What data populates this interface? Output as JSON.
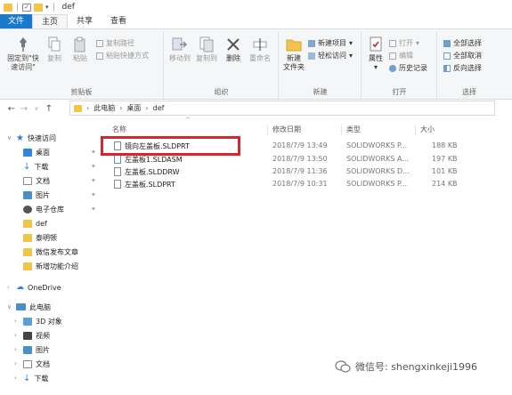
{
  "window": {
    "title": "def"
  },
  "tabs": [
    "文件",
    "主页",
    "共享",
    "查看"
  ],
  "ribbon": {
    "clipboard": {
      "pin_label": "固定到\"快\n速访问\"",
      "copy_label": "复制",
      "paste_label": "粘贴",
      "copy_path_label": "复制路径",
      "paste_shortcut_label": "粘贴快捷方式",
      "group_label": "剪贴板"
    },
    "organize": {
      "move_label": "移动到",
      "copyto_label": "复制到",
      "delete_label": "删除",
      "rename_label": "重命名",
      "group_label": "组织"
    },
    "new": {
      "new_folder_label": "新建\n文件夹",
      "new_item_label": "新建项目",
      "easy_access_label": "轻松访问",
      "group_label": "新建"
    },
    "open": {
      "properties_label": "属性",
      "open_label": "打开",
      "edit_label": "编辑",
      "history_label": "历史记录",
      "group_label": "打开"
    },
    "select": {
      "select_all_label": "全部选择",
      "select_none_label": "全部取消",
      "invert_label": "反向选择",
      "group_label": "选择"
    }
  },
  "address": {
    "crumbs": [
      "此电脑",
      "桌面",
      "def"
    ]
  },
  "navpane": {
    "quick_access": "快速访问",
    "items": [
      "桌面",
      "下载",
      "文档",
      "图片",
      "电子仓库",
      "def",
      "泰明顿",
      "微信发布文章",
      "新增功能介绍"
    ],
    "onedrive": "OneDrive",
    "this_pc": "此电脑",
    "pc_items": [
      "3D 对象",
      "视频",
      "图片",
      "文档",
      "下载"
    ]
  },
  "filelist": {
    "columns": {
      "name": "名称",
      "date": "修改日期",
      "type": "类型",
      "size": "大小"
    },
    "rows": [
      {
        "name": "镜向左盖板.SLDPRT",
        "date": "2018/7/9 13:49",
        "type": "SOLIDWORKS P...",
        "size": "188 KB"
      },
      {
        "name": "左盖板1.SLDASM",
        "date": "2018/7/9 13:50",
        "type": "SOLIDWORKS A...",
        "size": "197 KB"
      },
      {
        "name": "左盖板.SLDDRW",
        "date": "2018/7/9 11:36",
        "type": "SOLIDWORKS D...",
        "size": "101 KB"
      },
      {
        "name": "左盖板.SLDPRT",
        "date": "2018/7/9 10:31",
        "type": "SOLIDWORKS P...",
        "size": "214 KB"
      }
    ]
  },
  "watermark": {
    "text": "微信号: shengxinkeji1996"
  },
  "colors": {
    "accent": "#1979ca",
    "highlight": "#d9262c",
    "folder": "#f3c34a"
  }
}
